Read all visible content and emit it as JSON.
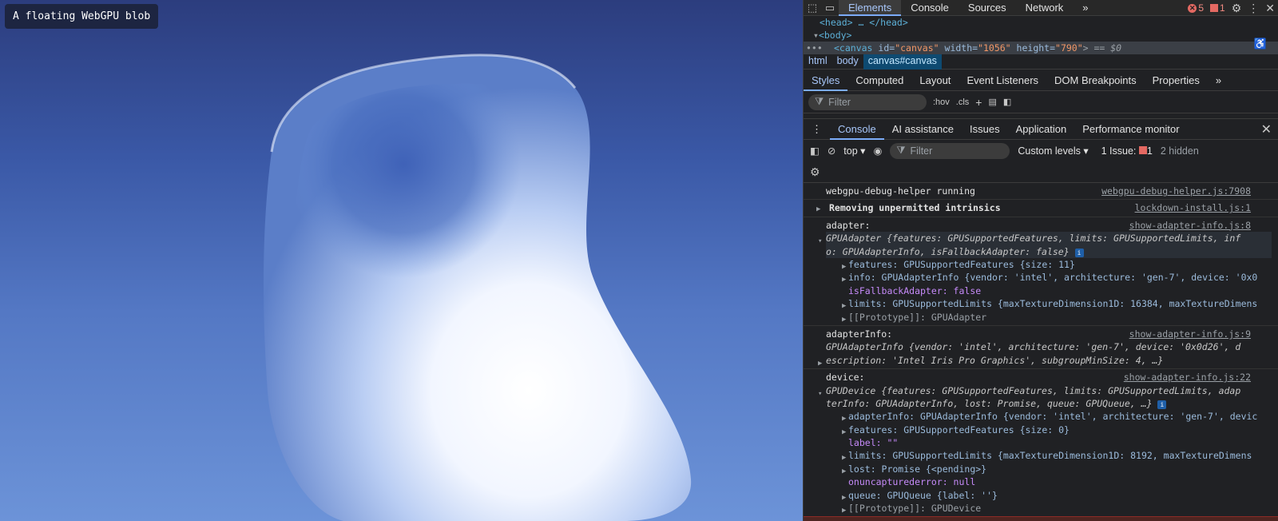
{
  "page": {
    "label": "A floating WebGPU blob",
    "colors": {
      "bg_top": "#2c3d7e",
      "bg_bottom": "#6c93d8",
      "blob_light": "#ffffff",
      "blob_dark": "#3e63b8"
    }
  },
  "devtools": {
    "tabs": [
      "Elements",
      "Console",
      "Sources",
      "Network"
    ],
    "more_tabs": "»",
    "error_count": "5",
    "issue_count": "1",
    "dom": {
      "line1": "<head> … </head>",
      "body_tag": "<body>",
      "canvas_tag": "<canvas",
      "canvas_id_attr": "id=",
      "canvas_id_val": "\"canvas\"",
      "canvas_w_attr": "width=",
      "canvas_w_val": "\"1056\"",
      "canvas_h_attr": "height=",
      "canvas_h_val": "\"790\"",
      "canvas_end": "> == $0",
      "ellipsis": "•••"
    },
    "breadcrumbs": [
      "html",
      "body",
      "canvas#canvas"
    ],
    "subtabs": [
      "Styles",
      "Computed",
      "Layout",
      "Event Listeners",
      "DOM Breakpoints",
      "Properties"
    ],
    "filter_placeholder": "Filter",
    "hov": ":hov",
    "cls": ".cls",
    "drawer_tabs": [
      "Console",
      "AI assistance",
      "Issues",
      "Application",
      "Performance monitor"
    ],
    "close": "✕",
    "console_toolbar": {
      "context": "top",
      "filter": "Filter",
      "levels": "Custom levels",
      "issues_label": "1 Issue:",
      "issues_count": "1",
      "hidden": "2 hidden"
    },
    "log": {
      "m1": {
        "text": "webgpu-debug-helper running",
        "src": "webgpu-debug-helper.js:7908"
      },
      "m2": {
        "text": "Removing unpermitted intrinsics",
        "src": "lockdown-install.js:1"
      },
      "m3": {
        "label": "adapter:",
        "src": "show-adapter-info.js:8",
        "summary1": "GPUAdapter {features: GPUSupportedFeatures, limits: GPUSupportedLimits, inf",
        "summary2": "o: GPUAdapterInfo, isFallbackAdapter: false}",
        "features": "features: GPUSupportedFeatures {size: 11}",
        "info": "info: GPUAdapterInfo {vendor: 'intel', architecture: 'gen-7', device: '0x0",
        "fallback": "isFallbackAdapter: false",
        "limits": "limits: GPUSupportedLimits {maxTextureDimension1D: 16384, maxTextureDimens",
        "proto": "[[Prototype]]: GPUAdapter"
      },
      "m4": {
        "label": "adapterInfo:",
        "src": "show-adapter-info.js:9",
        "summary1": "GPUAdapterInfo {vendor: 'intel', architecture: 'gen-7', device: '0x0d26', d",
        "summary2": "escription: 'Intel Iris Pro Graphics', subgroupMinSize: 4, …}"
      },
      "m5": {
        "label": "device:",
        "src": "show-adapter-info.js:22",
        "summary1": "GPUDevice {features: GPUSupportedFeatures, limits: GPUSupportedLimits, adap",
        "summary2": "terInfo: GPUAdapterInfo, lost: Promise, queue: GPUQueue, …}",
        "adapterInfo": "adapterInfo: GPUAdapterInfo {vendor: 'intel', architecture: 'gen-7', devic",
        "features": "features: GPUSupportedFeatures {size: 0}",
        "label_prop": "label: \"\"",
        "limits": "limits: GPUSupportedLimits {maxTextureDimension1D: 8192, maxTextureDimens",
        "lost": "lost: Promise {<pending>}",
        "onerr": "onuncapturederror: null",
        "queue": "queue: GPUQueue {label: ''}",
        "proto": "[[Prototype]]: GPUDevice"
      }
    }
  }
}
